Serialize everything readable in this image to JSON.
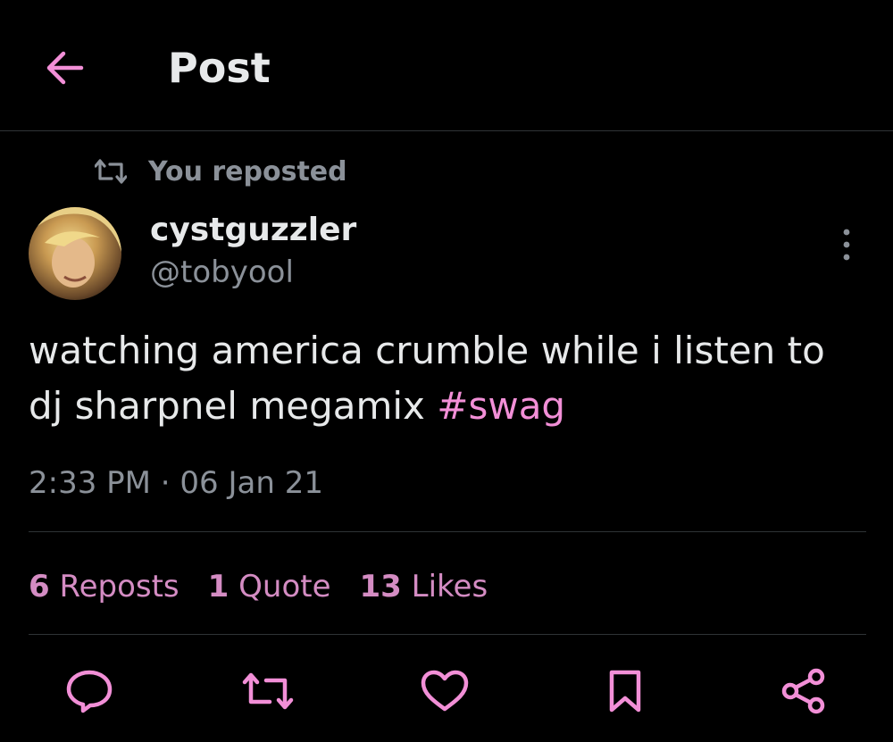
{
  "header": {
    "title": "Post",
    "back_icon": "arrow-left-icon"
  },
  "repost_banner": {
    "text": "You reposted",
    "icon": "repost-icon"
  },
  "author": {
    "display_name": "cystguzzler",
    "handle": "@tobyool"
  },
  "post": {
    "text": "watching america crumble while i listen to dj sharpnel megamix ",
    "hashtag": "#swag",
    "timestamp": "2:33 PM · 06 Jan 21"
  },
  "stats": {
    "reposts": {
      "count": "6",
      "label": "Reposts"
    },
    "quotes": {
      "count": "1",
      "label": "Quote"
    },
    "likes": {
      "count": "13",
      "label": "Likes"
    }
  },
  "actions": [
    "reply-icon",
    "repost-icon",
    "like-icon",
    "bookmark-icon",
    "share-icon"
  ],
  "colors": {
    "accent": "#f28fd7",
    "stats": "#d48cc3",
    "muted": "#8b9199",
    "text": "#e7e9ea",
    "divider": "#2f3336",
    "background": "#000000"
  }
}
